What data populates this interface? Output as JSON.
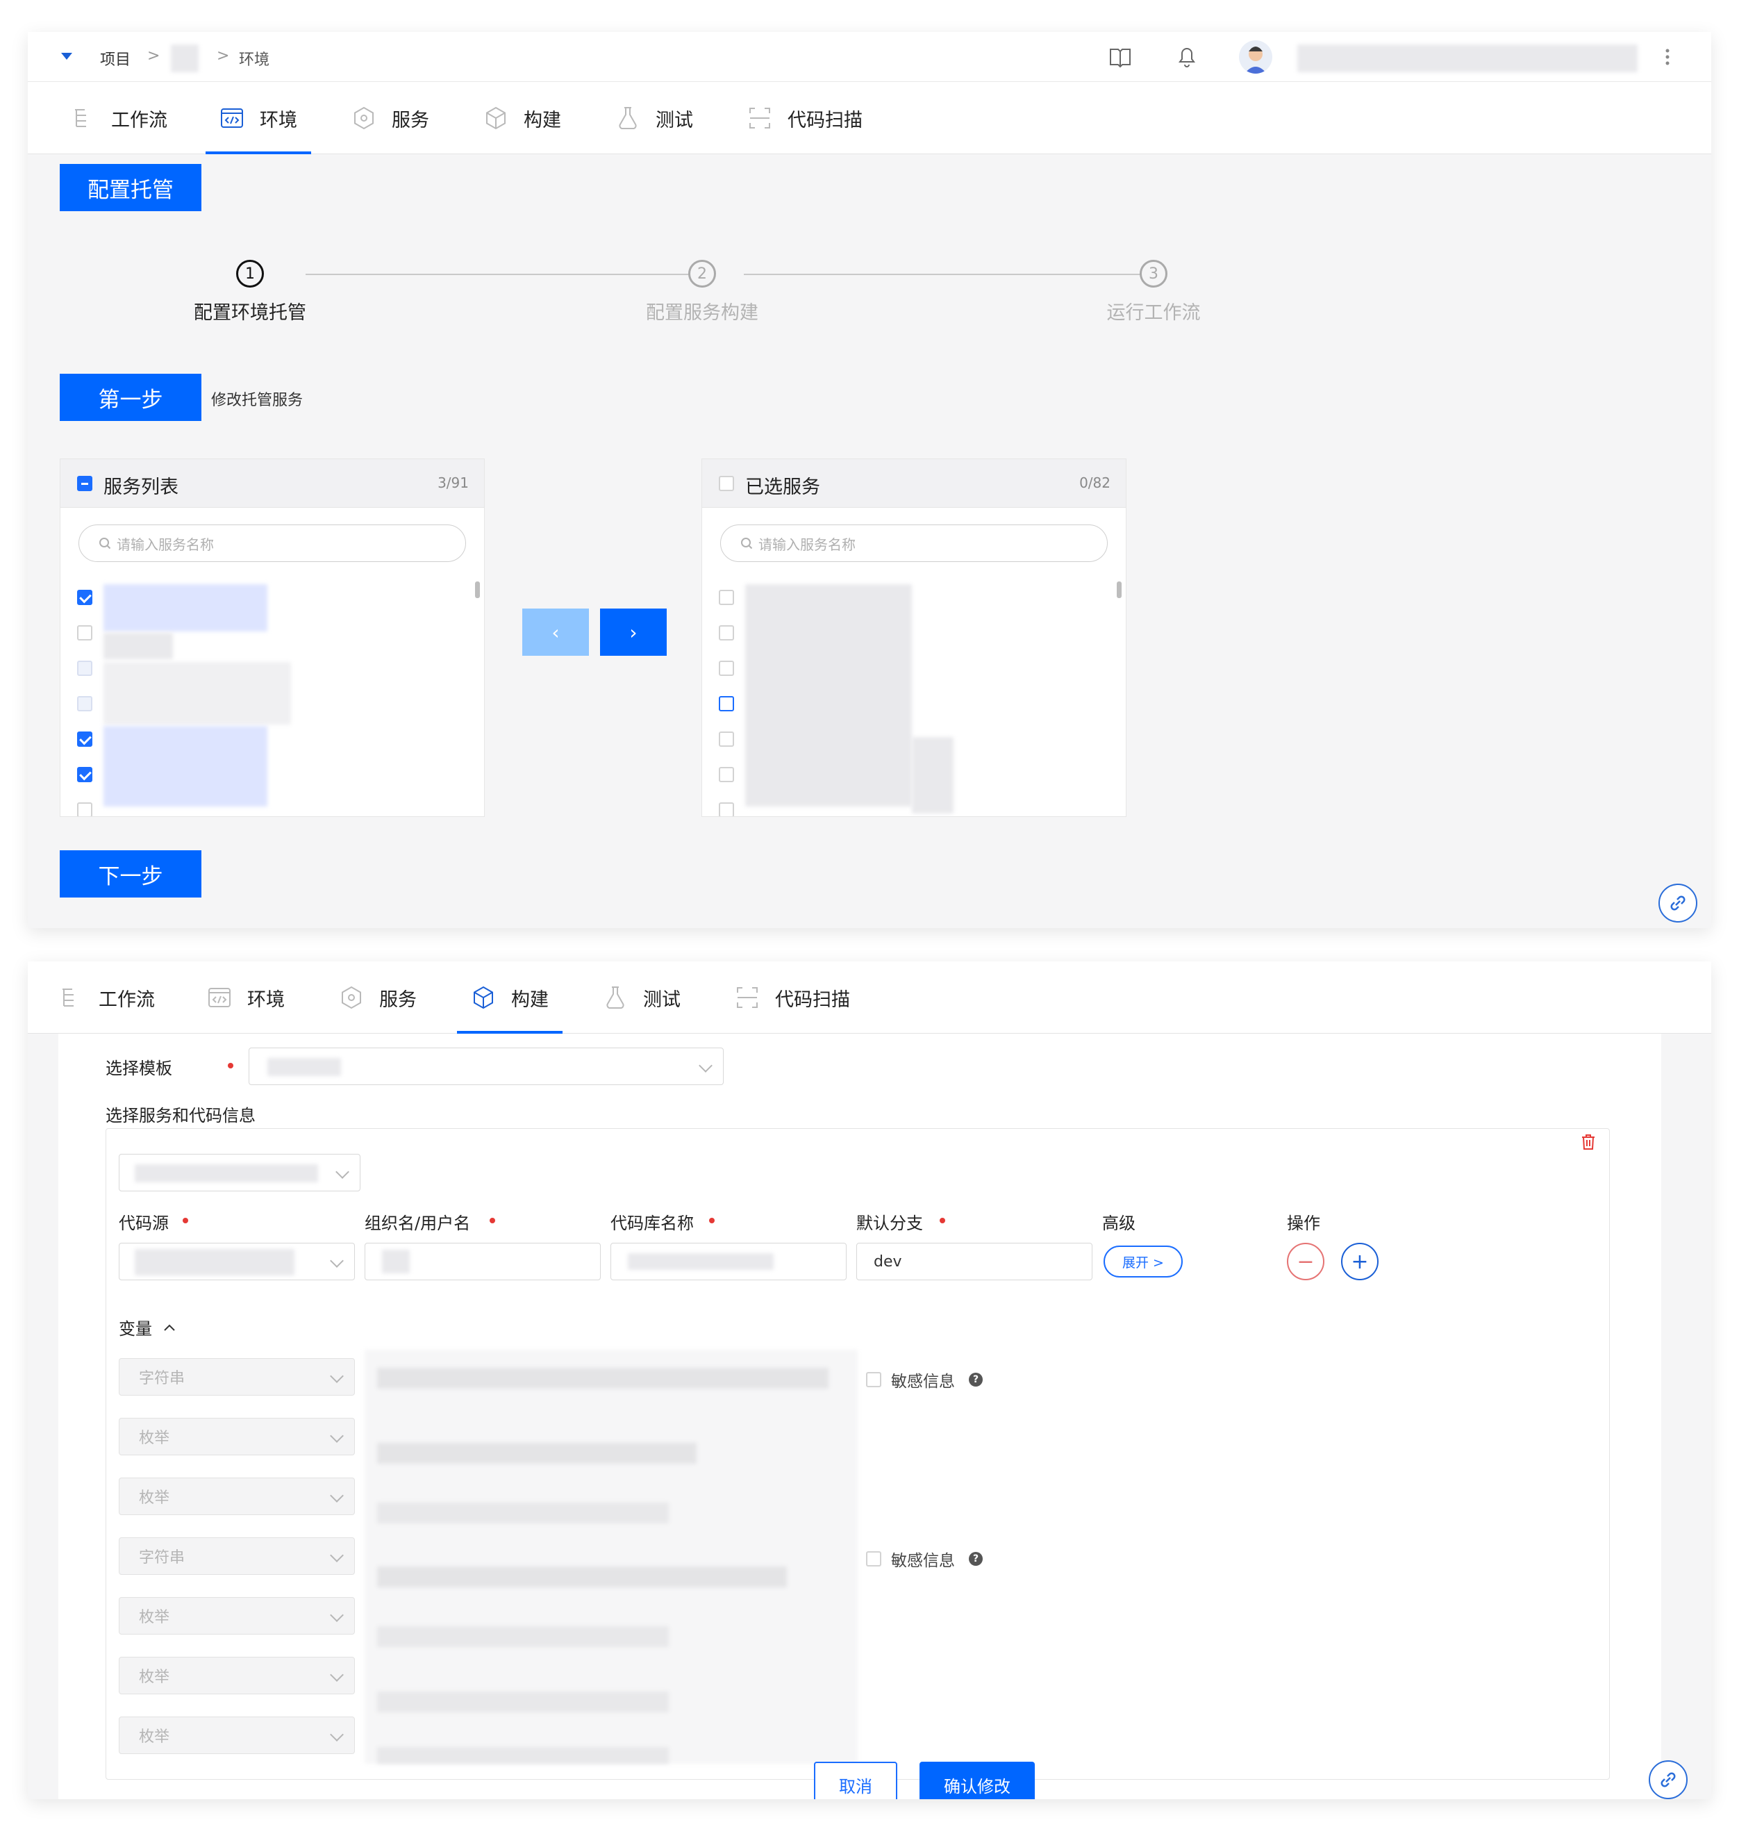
{
  "top": {
    "breadcrumb_project": "项目",
    "breadcrumb_sep": ">",
    "breadcrumb_env": "环境"
  },
  "tabs": [
    {
      "label": "工作流",
      "icon": "workflow-icon"
    },
    {
      "label": "环境",
      "icon": "environment-icon"
    },
    {
      "label": "服务",
      "icon": "service-icon"
    },
    {
      "label": "构建",
      "icon": "build-icon"
    },
    {
      "label": "测试",
      "icon": "test-icon"
    },
    {
      "label": "代码扫描",
      "icon": "code-scan-icon"
    }
  ],
  "panel1": {
    "header_button": "配置托管",
    "steps": [
      {
        "num": "1",
        "label": "配置环境托管"
      },
      {
        "num": "2",
        "label": "配置服务构建"
      },
      {
        "num": "3",
        "label": "运行工作流"
      }
    ],
    "step_badge": "第一步",
    "step_desc": "修改托管服务",
    "left_box": {
      "title": "服务列表",
      "count": "3/91",
      "placeholder": "请输入服务名称"
    },
    "right_box": {
      "title": "已选服务",
      "count": "0/82",
      "placeholder": "请输入服务名称"
    },
    "move_left": "‹",
    "move_right": "›",
    "next_button": "下一步"
  },
  "panel2": {
    "template_label": "选择模板",
    "services_label": "选择服务和代码信息",
    "col_source": "代码源",
    "col_org": "组织名/用户名",
    "col_repo": "代码库名称",
    "col_branch": "默认分支",
    "col_advanced": "高级",
    "col_actions": "操作",
    "branch_value": "dev",
    "expand_button": "展开 >",
    "variables_label": "变量",
    "variable_types": [
      "字符串",
      "枚举",
      "枚举",
      "字符串",
      "枚举",
      "枚举",
      "枚举"
    ],
    "sensitive_label": "敏感信息",
    "cancel_button": "取消",
    "confirm_button": "确认修改"
  },
  "colors": {
    "primary": "#0066ff",
    "danger": "#e53935"
  }
}
